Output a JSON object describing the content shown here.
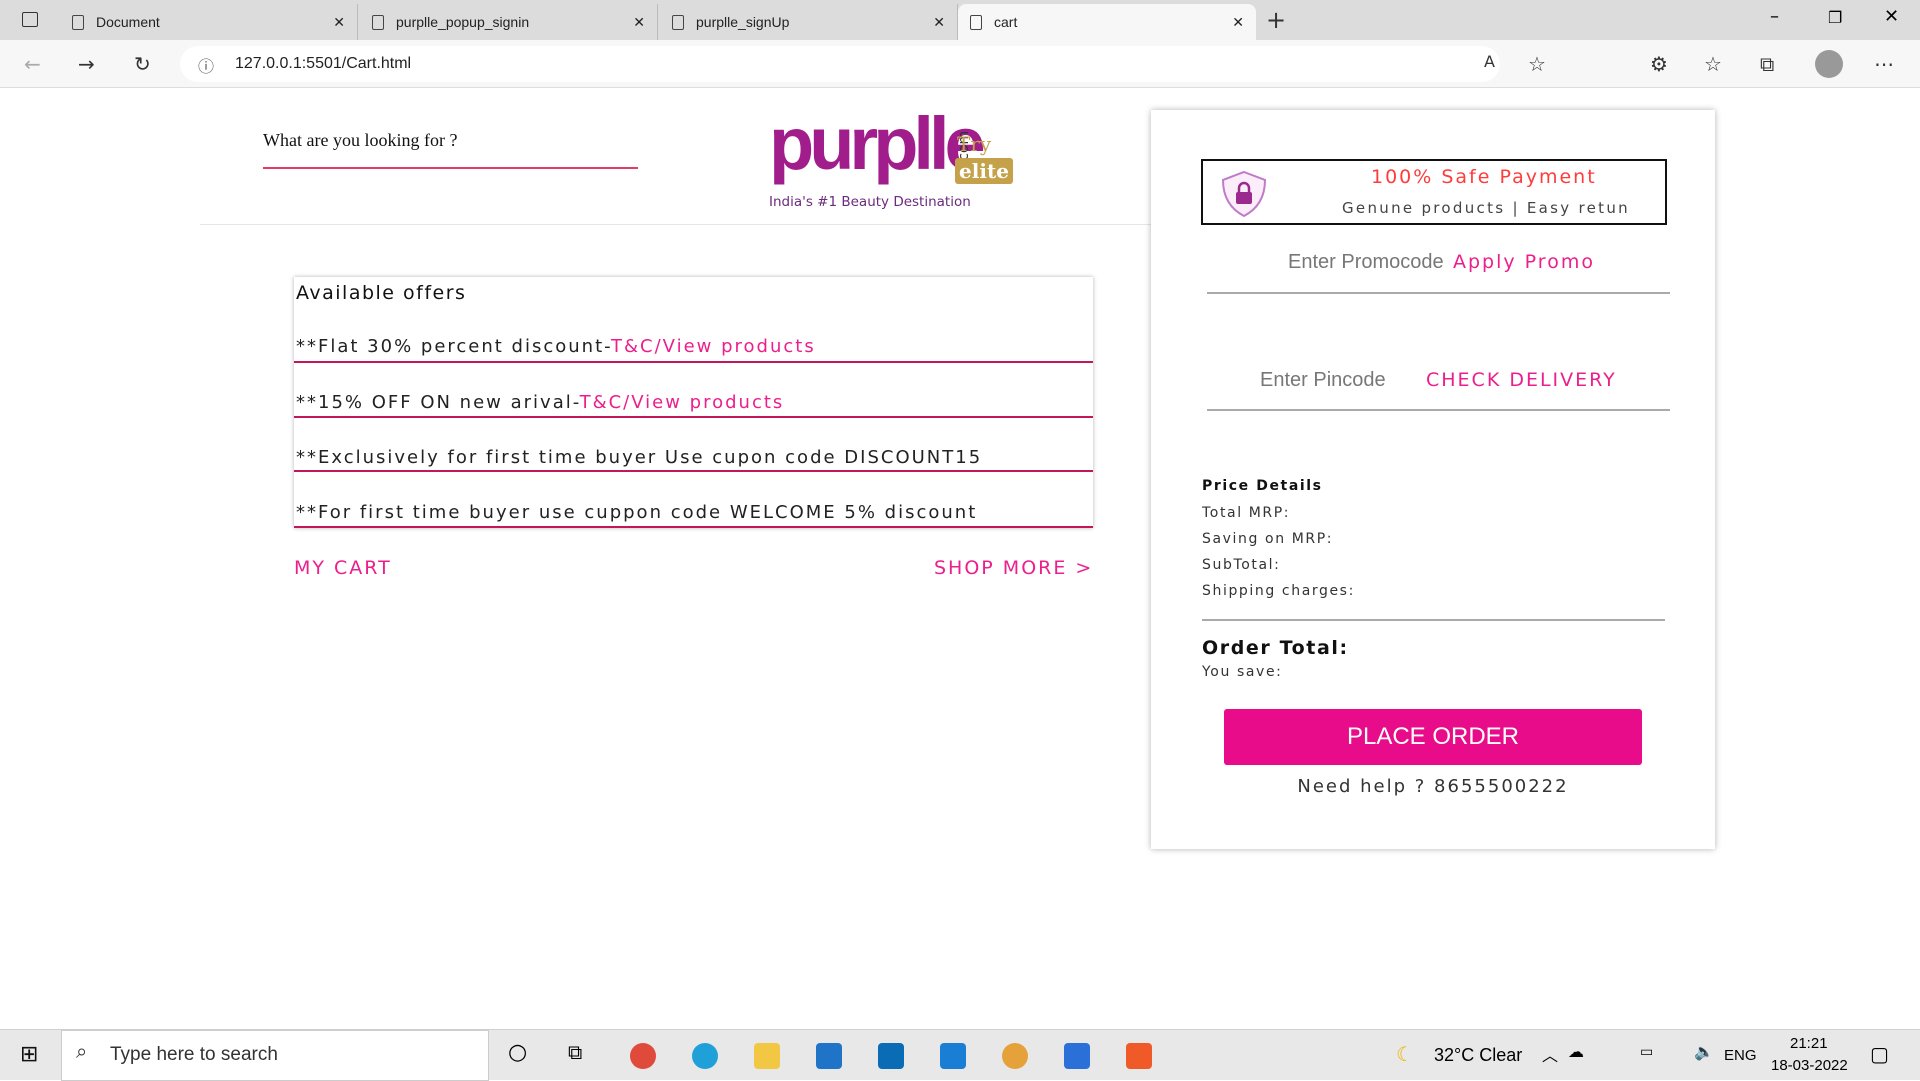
{
  "browser": {
    "tabs": [
      {
        "label": "Document"
      },
      {
        "label": "purplle_popup_signin"
      },
      {
        "label": "purplle_signUp"
      },
      {
        "label": "cart"
      }
    ],
    "url": "127.0.0.1:5501/Cart.html"
  },
  "header": {
    "search_placeholder": "What are you looking for ?",
    "logo_text": "purplle",
    "logo_com": ".com",
    "logo_try": "Try",
    "logo_elite": "elite",
    "tagline": "India's #1 Beauty Destination"
  },
  "offers": {
    "title": "Available offers",
    "items": [
      {
        "text": "**Flat 30% percent discount-",
        "link": "T&C/View products"
      },
      {
        "text": "**15% OFF ON new arival-",
        "link": "T&C/View products"
      },
      {
        "text": "**Exclusively for first time buyer Use cupon code DISCOUNT15",
        "link": ""
      },
      {
        "text": "**For first time buyer use cuppon code WELCOME 5% discount",
        "link": ""
      }
    ]
  },
  "my_cart": "MY CART",
  "shop_more": "SHOP MORE >",
  "panel": {
    "safe_title": "100% Safe Payment",
    "safe_sub": "Genune products | Easy retun",
    "promo_placeholder": "Enter Promocode",
    "apply_promo": "Apply Promo",
    "pincode_placeholder": "Enter Pincode",
    "check_delivery": "CHECK DELIVERY",
    "price_details": "Price Details",
    "rows": [
      "Total MRP:",
      "Saving on MRP:",
      "SubTotal:",
      "Shipping charges:"
    ],
    "order_total": "Order Total:",
    "you_save": "You save:",
    "place_order": "PLACE ORDER",
    "help": "Need help ? 8655500222"
  },
  "taskbar": {
    "search_placeholder": "Type here to search",
    "weather": "32°C  Clear",
    "lang": "ENG",
    "time": "21:21",
    "date": "18-03-2022"
  }
}
